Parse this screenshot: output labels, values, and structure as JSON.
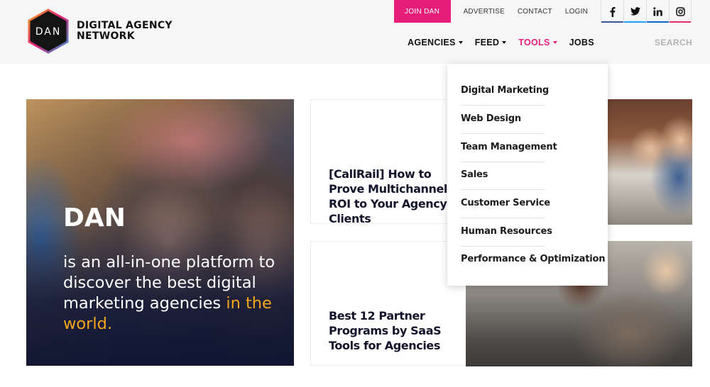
{
  "logo": {
    "mark": "DAN",
    "line1": "DIGITAL AGENCY",
    "line2": "NETWORK"
  },
  "topbar": {
    "join": "JOIN DAN",
    "links": [
      "ADVERTISE",
      "CONTACT",
      "LOGIN"
    ],
    "social": [
      {
        "name": "facebook-icon",
        "glyph": "f"
      },
      {
        "name": "twitter-icon",
        "glyph": "🐦"
      },
      {
        "name": "linkedin-icon",
        "glyph": "in"
      },
      {
        "name": "instagram-icon",
        "glyph": "◎"
      }
    ]
  },
  "nav": {
    "agencies": "AGENCIES",
    "feed": "FEED",
    "tools": "TOOLS",
    "jobs": "JOBS",
    "search": "SEARCH"
  },
  "dropdown": {
    "items": [
      "Digital Marketing",
      "Web Design",
      "Team Management",
      "Sales",
      "Customer Service",
      "Human Resources",
      "Performance & Optimization"
    ]
  },
  "hero": {
    "title": "DAN",
    "text_main": "is an all-in-one platform to discover the best digital marketing agencies",
    "text_highlight": "in the world."
  },
  "articles": [
    {
      "title": "[CallRail] How to Prove Multichannel ROI to Your Agency Clients"
    },
    {
      "title": "Best 12 Partner Programs by SaaS Tools for Agencies"
    }
  ],
  "colors": {
    "accent": "#e61e7a",
    "highlight": "#f4a51c",
    "search": "#b3b3b3"
  }
}
